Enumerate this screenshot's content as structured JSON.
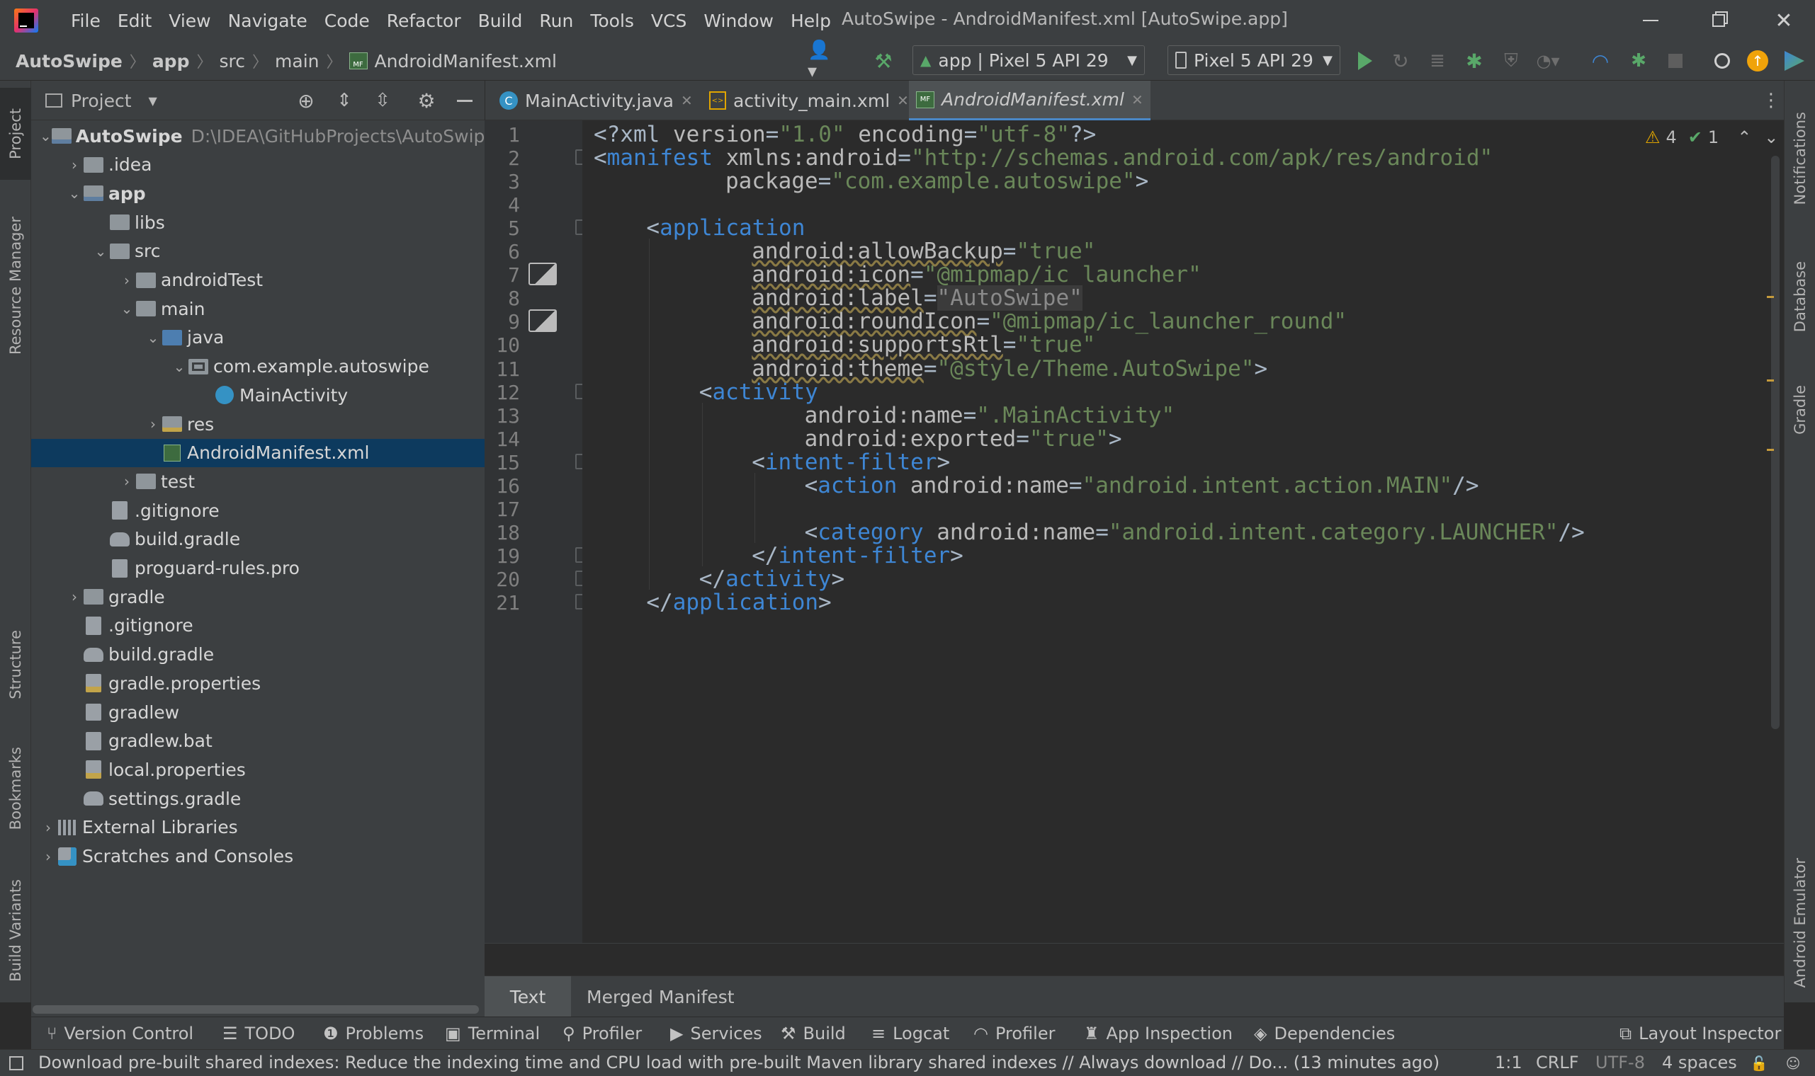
{
  "window": {
    "title": "AutoSwipe - AndroidManifest.xml [AutoSwipe.app]",
    "menu": [
      "File",
      "Edit",
      "View",
      "Navigate",
      "Code",
      "Refactor",
      "Build",
      "Run",
      "Tools",
      "VCS",
      "Window",
      "Help"
    ]
  },
  "breadcrumb": [
    "AutoSwipe",
    "app",
    "src",
    "main",
    "AndroidManifest.xml"
  ],
  "toolbar": {
    "run_config": "app | Pixel 5 API 29",
    "device": "Pixel 5 API 29"
  },
  "project_panel": {
    "title": "Project",
    "tree": [
      {
        "label": "AutoSwipe",
        "extra": "D:\\IDEA\\GitHubProjects\\AutoSwipe",
        "depth": 0,
        "arrow": "down",
        "icon": "module-folder-icon"
      },
      {
        "label": ".idea",
        "depth": 1,
        "arrow": "right",
        "icon": "folder-icon"
      },
      {
        "label": "app",
        "depth": 1,
        "arrow": "down",
        "icon": "module-folder-icon"
      },
      {
        "label": "libs",
        "depth": 2,
        "arrow": "",
        "icon": "folder-icon"
      },
      {
        "label": "src",
        "depth": 2,
        "arrow": "down",
        "icon": "folder-icon"
      },
      {
        "label": "androidTest",
        "depth": 3,
        "arrow": "right",
        "icon": "folder-icon"
      },
      {
        "label": "main",
        "depth": 3,
        "arrow": "down",
        "icon": "folder-icon"
      },
      {
        "label": "java",
        "depth": 4,
        "arrow": "down",
        "icon": "source-folder-icon"
      },
      {
        "label": "com.example.autoswipe",
        "depth": 5,
        "arrow": "down",
        "icon": "package-icon"
      },
      {
        "label": "MainActivity",
        "depth": 6,
        "arrow": "",
        "icon": "java-class-icon"
      },
      {
        "label": "res",
        "depth": 4,
        "arrow": "right",
        "icon": "res-folder-icon"
      },
      {
        "label": "AndroidManifest.xml",
        "depth": 4,
        "arrow": "",
        "icon": "manifest-file-icon",
        "selected": true
      },
      {
        "label": "test",
        "depth": 3,
        "arrow": "right",
        "icon": "folder-icon"
      },
      {
        "label": ".gitignore",
        "depth": 2,
        "arrow": "",
        "icon": "gitignore-file-icon"
      },
      {
        "label": "build.gradle",
        "depth": 2,
        "arrow": "",
        "icon": "gradle-elephant-icon"
      },
      {
        "label": "proguard-rules.pro",
        "depth": 2,
        "arrow": "",
        "icon": "text-file-icon"
      },
      {
        "label": "gradle",
        "depth": 1,
        "arrow": "right",
        "icon": "folder-icon"
      },
      {
        "label": ".gitignore",
        "depth": 1,
        "arrow": "",
        "icon": "gitignore-file-icon"
      },
      {
        "label": "build.gradle",
        "depth": 1,
        "arrow": "",
        "icon": "gradle-elephant-icon"
      },
      {
        "label": "gradle.properties",
        "depth": 1,
        "arrow": "",
        "icon": "properties-file-icon"
      },
      {
        "label": "gradlew",
        "depth": 1,
        "arrow": "",
        "icon": "shell-script-icon"
      },
      {
        "label": "gradlew.bat",
        "depth": 1,
        "arrow": "",
        "icon": "text-file-icon"
      },
      {
        "label": "local.properties",
        "depth": 1,
        "arrow": "",
        "icon": "properties-file-icon"
      },
      {
        "label": "settings.gradle",
        "depth": 1,
        "arrow": "",
        "icon": "gradle-elephant-icon"
      },
      {
        "label": "External Libraries",
        "depth": 0,
        "arrow": "right",
        "icon": "libraries-icon"
      },
      {
        "label": "Scratches and Consoles",
        "depth": 0,
        "arrow": "right",
        "icon": "scratches-icon"
      }
    ]
  },
  "editor_tabs": [
    {
      "label": "MainActivity.java",
      "icon": "java-class-icon"
    },
    {
      "label": "activity_main.xml",
      "icon": "layout-file-icon"
    },
    {
      "label": "AndroidManifest.xml",
      "icon": "manifest-file-icon",
      "active": true
    }
  ],
  "inspections": {
    "warnings": "4",
    "ok": "1"
  },
  "code_lines": [
    "1",
    "2",
    "3",
    "4",
    "5",
    "6",
    "7",
    "8",
    "9",
    "10",
    "11",
    "12",
    "13",
    "14",
    "15",
    "16",
    "17",
    "18",
    "19",
    "20",
    "21"
  ],
  "code": {
    "l1_a": "<?xml ",
    "l1_b": "version",
    "l1_c": "=",
    "l1_d": "\"1.0\"",
    "l1_e": " encoding",
    "l1_f": "=",
    "l1_g": "\"utf-8\"",
    "l1_h": "?>",
    "l2_a": "<",
    "l2_b": "manifest",
    "l2_c": " xmlns:android",
    "l2_d": "=",
    "l2_e": "\"http://schemas.android.com/apk/res/android\"",
    "l3_a": "package",
    "l3_b": "=",
    "l3_c": "\"com.example.autoswipe\"",
    "l3_d": ">",
    "l5_a": "<",
    "l5_b": "application",
    "l6_a": "android:allowBackup",
    "l6_b": "=",
    "l6_c": "\"true\"",
    "l7_a": "android:icon",
    "l7_b": "=",
    "l7_c": "\"@mipmap/ic_launcher\"",
    "l8_a": "android:label",
    "l8_b": "=",
    "l8_c": "\"AutoSwipe\"",
    "l9_a": "android:roundIcon",
    "l9_b": "=",
    "l9_c": "\"@mipmap/ic_launcher_round\"",
    "l10_a": "android:supportsRtl",
    "l10_b": "=",
    "l10_c": "\"true\"",
    "l11_a": "android:theme",
    "l11_b": "=",
    "l11_c": "\"@style/Theme.AutoSwipe\"",
    "l11_d": ">",
    "l12_a": "<",
    "l12_b": "activity",
    "l13_a": "android:name",
    "l13_b": "=",
    "l13_c": "\".MainActivity\"",
    "l14_a": "android:exported",
    "l14_b": "=",
    "l14_c": "\"true\"",
    "l14_d": ">",
    "l15_a": "<",
    "l15_b": "intent-filter",
    "l15_c": ">",
    "l16_a": "<",
    "l16_b": "action",
    "l16_c": " android:name",
    "l16_d": "=",
    "l16_e": "\"android.intent.action.MAIN\"",
    "l16_f": "/>",
    "l18_a": "<",
    "l18_b": "category",
    "l18_c": " android:name",
    "l18_d": "=",
    "l18_e": "\"android.intent.category.LAUNCHER\"",
    "l18_f": "/>",
    "l19_a": "</",
    "l19_b": "intent-filter",
    "l19_c": ">",
    "l20_a": "</",
    "l20_b": "activity",
    "l20_c": ">",
    "l21_a": "</",
    "l21_b": "application",
    "l21_c": ">"
  },
  "editor_bottom_tabs": [
    "Text",
    "Merged Manifest"
  ],
  "left_strip": [
    "Project",
    "Resource Manager",
    "Structure",
    "Bookmarks",
    "Build Variants"
  ],
  "right_strip": [
    "Notifications",
    "Database",
    "Gradle",
    "Android Emulator"
  ],
  "tool_windows": [
    "Version Control",
    "TODO",
    "Problems",
    "Terminal",
    "Profiler",
    "Services",
    "Build",
    "Logcat",
    "Profiler",
    "App Inspection",
    "Dependencies"
  ],
  "layout_inspector": "Layout Inspector",
  "status": {
    "message": "Download pre-built shared indexes: Reduce the indexing time and CPU load with pre-built Maven library shared indexes // Always download // Do... (13 minutes ago)",
    "position": "1:1",
    "line_sep": "CRLF",
    "encoding": "UTF-8",
    "indent": "4 spaces"
  },
  "colors": {
    "accent": "#4a88c7",
    "selection": "#0d3a5e",
    "run": "#59a869",
    "warning": "#e0a500"
  }
}
